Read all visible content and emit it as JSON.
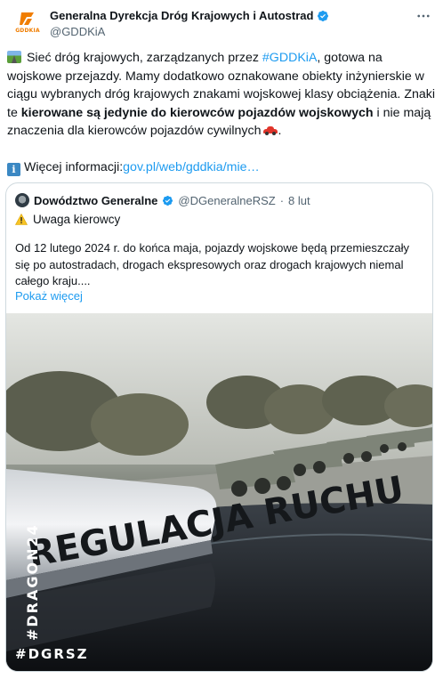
{
  "author": {
    "display_name": "Generalna Dyrekcja Dróg Krajowych i Autostrad",
    "handle": "@GDDKiA",
    "logo_text": "GDDKIA",
    "verified_icon": "verified-badge-icon",
    "more_icon": "more-options-icon"
  },
  "tweet": {
    "p1_a": "Sieć dróg krajowych, zarządzanych przez ",
    "p1_link": "#GDDKiA",
    "p1_b": ", gotowa na wojskowe przejazdy. Mamy dodatkowo oznakowane obiekty inżynierskie w ciągu wybranych dróg krajowych znakami wojskowej klasy obciążenia. Znaki te ",
    "p1_bold": "kierowane są jedynie do kierowców pojazdów wojskowych",
    "p1_c": " i nie mają znaczenia dla kierowców pojazdów cywilnych",
    "p2_a": "Więcej informacji:",
    "p2_link": "gov.pl/web/gddkia/mie…"
  },
  "quote": {
    "display_name": "Dowództwo Generalne",
    "handle": "@DGeneralneRSZ",
    "separator": "·",
    "date": "8 lut",
    "warning": "Uwaga kierowcy",
    "body": "Od 12 lutego 2024 r. do końca maja, pojazdy wojskowe będą przemieszczały się po autostradach, drogach ekspresowych oraz drogach krajowych niemal całego kraju....",
    "show_more": "Pokaż więcej",
    "image": {
      "sign_text": "REGULACJA RUCHU",
      "watermark_1": "#DRAGON24",
      "watermark_2": "#DGRSZ"
    }
  },
  "colors": {
    "link": "#1d9bf0",
    "verified": "#1d9bf0",
    "secondary_text": "#536471",
    "brand_orange": "#f07d00"
  }
}
